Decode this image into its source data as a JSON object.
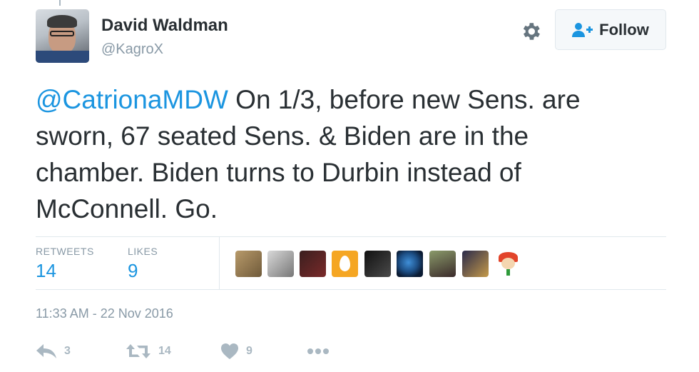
{
  "author": {
    "name": "David Waldman",
    "handle": "@KagroX"
  },
  "follow_button": {
    "label": "Follow"
  },
  "tweet": {
    "mention": "@CatrionaMDW",
    "line1_rest": " On 1/3, before new Sens. are",
    "line2": "sworn, 67 seated Sens. & Biden are in the",
    "line3": "chamber. Biden turns to Durbin instead of",
    "line4": "McConnell. Go."
  },
  "stats": {
    "retweets_label": "RETWEETS",
    "retweets_value": "14",
    "likes_label": "LIKES",
    "likes_value": "9"
  },
  "timestamp": "11:33 AM - 22 Nov 2016",
  "actions": {
    "reply_count": "3",
    "retweet_count": "14",
    "like_count": "9"
  },
  "colors": {
    "accent": "#1b95e0",
    "muted": "#8899a6",
    "icon": "#aab8c2",
    "text": "#292f33"
  },
  "icons": [
    "gear-icon",
    "follow-person-icon",
    "reply-icon",
    "retweet-icon",
    "heart-icon",
    "more-dots-icon"
  ]
}
